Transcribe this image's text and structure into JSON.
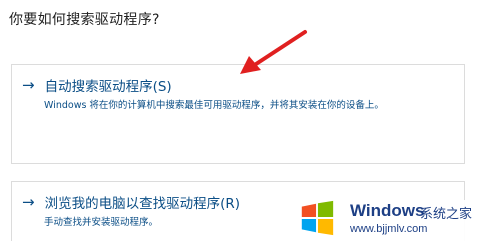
{
  "dialog": {
    "question": "你要如何搜索驱动程序?",
    "options": [
      {
        "arrow": "→",
        "title": "自动搜索驱动程序(S)",
        "description": "Windows 将在你的计算机中搜索最佳可用驱动程序，并将其安装在你的设备上。"
      },
      {
        "arrow": "→",
        "title": "浏览我的电脑以查找驱动程序(R)",
        "description": "手动查找并安装驱动程序。"
      }
    ]
  },
  "watermark": {
    "brand": "Windows",
    "site_name": "系统之家",
    "url": "www.bjjmlv.com"
  },
  "colors": {
    "link_blue": "#0b4e86",
    "annotation_red": "#e02020",
    "win_red": "#f25022",
    "win_green": "#7fba00",
    "win_blue": "#00a4ef",
    "win_yellow": "#ffb900"
  }
}
